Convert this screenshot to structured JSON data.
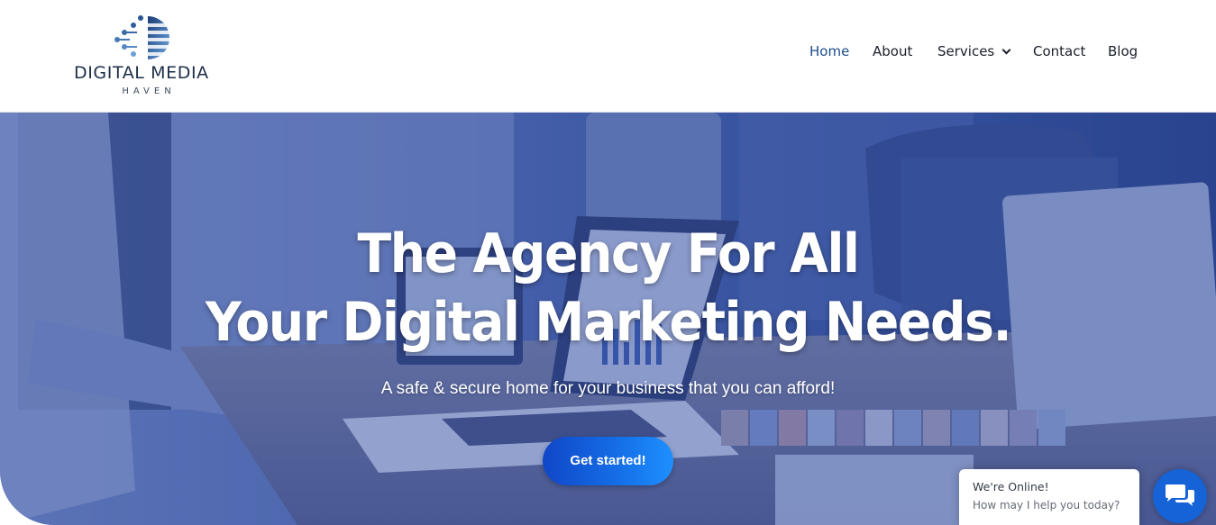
{
  "brand": {
    "name": "DIGITAL MEDIA",
    "tagline": "HAVEN",
    "colors": {
      "navy": "#1e2e48",
      "accent_blue": "#1c4c8c",
      "cta_blue": "#1570e8"
    }
  },
  "nav": {
    "items": [
      {
        "label": "Home",
        "active": true
      },
      {
        "label": "About",
        "active": false
      },
      {
        "label": "Services",
        "active": false,
        "dropdown": true
      },
      {
        "label": "Contact",
        "active": false
      },
      {
        "label": "Blog",
        "active": false
      }
    ]
  },
  "hero": {
    "title_line1": "The Agency For All",
    "title_line2": "Your Digital Marketing Needs.",
    "subtitle": "A safe & secure home for your business that you can afford!",
    "cta_label": "Get started!"
  },
  "chat": {
    "status": "We're Online!",
    "prompt": "How may I help you today?",
    "icon": "chat-bubbles-icon"
  }
}
